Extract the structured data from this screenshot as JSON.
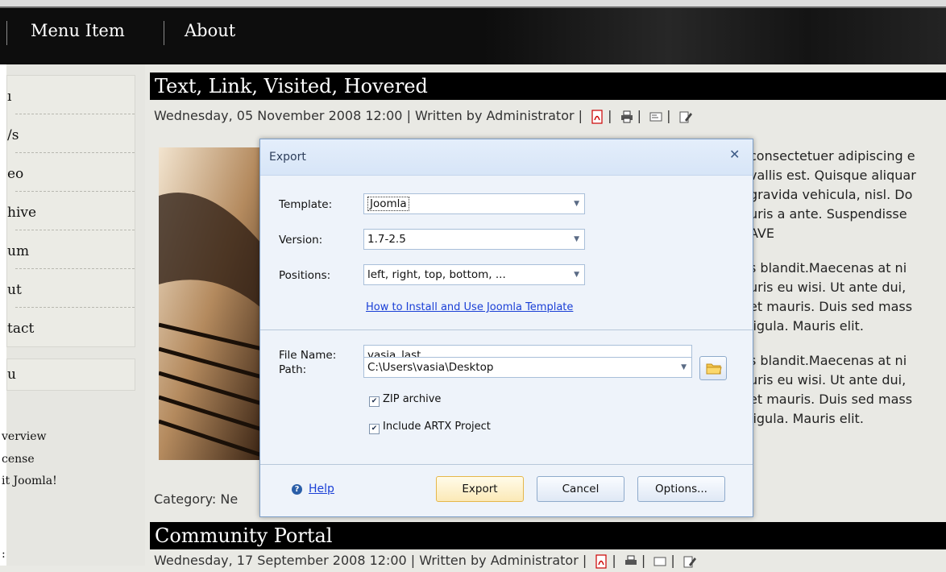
{
  "nav": {
    "items": [
      "Menu Item",
      "About"
    ]
  },
  "sidebar": {
    "menu_items": [
      "ı",
      "/s",
      "eo",
      "hive",
      "um",
      "ut",
      "tact"
    ],
    "box2_title": "u",
    "sub_items": [
      "verview",
      "cense",
      "it Joomla!"
    ],
    "bottom_char": ":"
  },
  "articles": [
    {
      "title": "Text, Link, Visited, Hovered",
      "meta": "Wednesday, 05 November 2008 12:00 | Written by Administrator |"
    },
    {
      "title": "Community Portal",
      "meta": "Wednesday, 17 September 2008 12:00 | Written by Administrator |"
    }
  ],
  "category": "Category: Ne",
  "body_lines": [
    "consectetuer adipiscing e",
    "vallis est. Quisque aliquar",
    "gravida vehicula, nisl. Do",
    "uris a ante. Suspendisse",
    "AVE",
    "s blandit.Maecenas at ni",
    "uris eu wisi. Ut ante dui,",
    "et mauris. Duis sed mass",
    "ligula. Mauris elit.",
    "s blandit.Maecenas at ni",
    "uris eu wisi. Ut ante dui,",
    "et mauris. Duis sed mass",
    "ligula. Mauris elit."
  ],
  "dialog": {
    "title": "Export",
    "template_label": "Template:",
    "template_value": "Joomla",
    "version_label": "Version:",
    "version_value": "1.7-2.5",
    "positions_label": "Positions:",
    "positions_value": "left, right, top, bottom, ...",
    "install_link": "How to Install and Use Joomla Template",
    "filename_label": "File Name:",
    "filename_value": "vasia_last",
    "path_label": "Path:",
    "path_value": "C:\\Users\\vasia\\Desktop",
    "zip_label": "ZIP archive",
    "zip_checked": true,
    "artx_label": "Include ARTX Project",
    "artx_checked": true,
    "help_label": "Help",
    "export_button": "Export",
    "cancel_button": "Cancel",
    "options_button": "Options..."
  },
  "colors": {
    "nav_bg": "#0d0d0d",
    "title_bg": "#000000",
    "dialog_bg": "#eef3fa",
    "link": "#1a3fd6",
    "primary_button_border": "#e5b74a"
  },
  "icons": [
    "pdf-icon",
    "print-icon",
    "email-icon",
    "edit-icon",
    "help-icon",
    "folder-icon",
    "close-icon",
    "chevron-down-icon"
  ]
}
